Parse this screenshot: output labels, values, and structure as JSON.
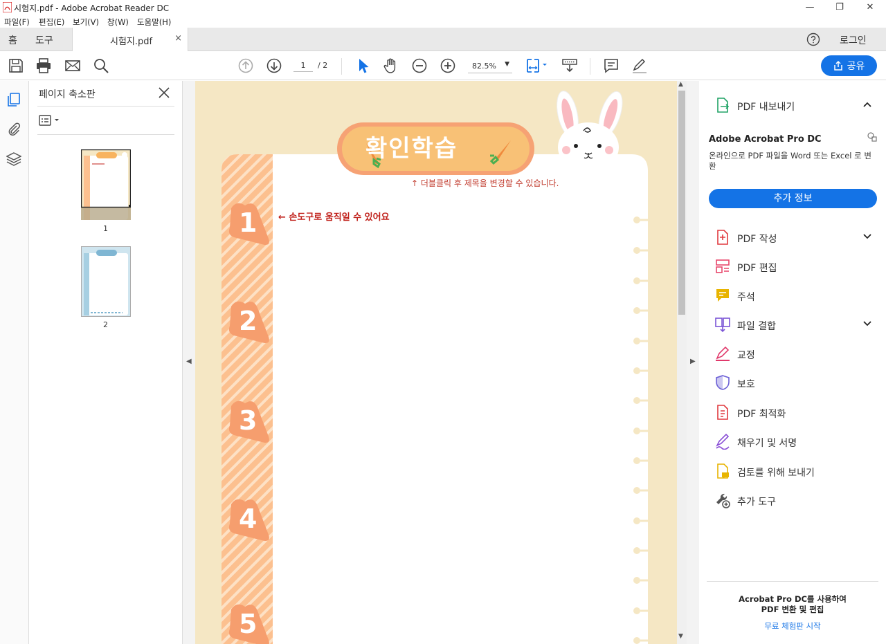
{
  "window": {
    "title": "시험지.pdf - Adobe Acrobat Reader DC",
    "minimize": "—",
    "maximize": "❐",
    "close": "✕"
  },
  "menu": [
    "파일(F)",
    "편집(E)",
    "보기(V)",
    "창(W)",
    "도움말(H)"
  ],
  "tabs": {
    "home": "홈",
    "tools": "도구",
    "document": "시험지.pdf",
    "close": "×",
    "login": "로그인"
  },
  "toolbar": {
    "page_current": "1",
    "page_total": "/ 2",
    "zoom": "82.5%",
    "share_label": "공유"
  },
  "thumbnails": {
    "title": "페이지 축소판",
    "pages": [
      "1",
      "2"
    ]
  },
  "document": {
    "header_title": "확인학습",
    "hint_title": "↑  더블클릭 후 제목을 변경할 수 있습니다.",
    "hint_move": "← 손도구로 움직일 수 있어요",
    "question_numbers": [
      "1",
      "2",
      "3",
      "4",
      "5"
    ]
  },
  "right_panel": {
    "export_pdf": "PDF 내보내기",
    "pro_title": "Adobe Acrobat Pro DC",
    "pro_desc": "온라인으로 PDF 파일을 Word 또는 Excel 로 변환",
    "more_info": "추가 정보",
    "tools": [
      {
        "label": "PDF 작성",
        "icon": "create-pdf-icon",
        "color": "#e0393e",
        "expandable": true
      },
      {
        "label": "PDF 편집",
        "icon": "edit-pdf-icon",
        "color": "#e8466b",
        "expandable": false
      },
      {
        "label": "주석",
        "icon": "comment-icon",
        "color": "#e8b400",
        "expandable": false
      },
      {
        "label": "파일 결합",
        "icon": "combine-files-icon",
        "color": "#7b55d6",
        "expandable": true
      },
      {
        "label": "교정",
        "icon": "redact-icon",
        "color": "#e0396b",
        "expandable": false
      },
      {
        "label": "보호",
        "icon": "protect-icon",
        "color": "#6b5fd6",
        "expandable": false
      },
      {
        "label": "PDF 최적화",
        "icon": "optimize-pdf-icon",
        "color": "#e0393e",
        "expandable": false
      },
      {
        "label": "채우기 및 서명",
        "icon": "fill-sign-icon",
        "color": "#8a4fd6",
        "expandable": false
      },
      {
        "label": "검토를 위해 보내기",
        "icon": "send-review-icon",
        "color": "#e8b400",
        "expandable": false
      },
      {
        "label": "추가 도구",
        "icon": "more-tools-icon",
        "color": "#555555",
        "expandable": false
      }
    ],
    "promo_line1": "Acrobat Pro DC를 사용하여",
    "promo_line2": "PDF 변환 및 편집",
    "promo_link": "무료 체험판 시작"
  },
  "colors": {
    "accent": "#1473e6",
    "doc_bg": "#f5e7c4",
    "carrot_strip": "#fcc08f",
    "title_pill": "#f8b35f",
    "hint_red": "#c0201a"
  }
}
